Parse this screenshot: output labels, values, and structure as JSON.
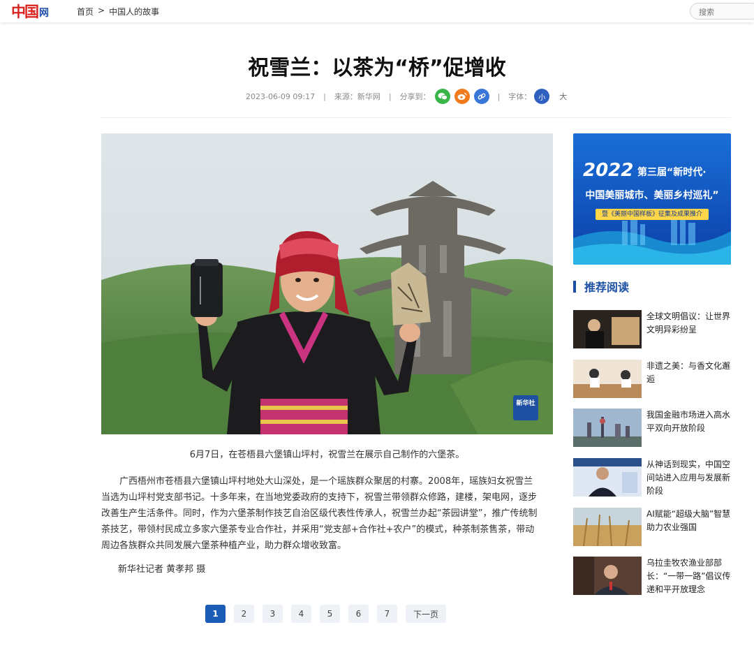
{
  "header": {
    "logo_text": "中国",
    "logo_suffix": "网",
    "breadcrumb": [
      "首页",
      ">",
      "中国人的故事"
    ],
    "search_placeholder": "搜索"
  },
  "article": {
    "title": "祝雪兰：以茶为“桥”促增收",
    "date": "2023-06-09 09:17",
    "source": "来源：新华网",
    "share_label": "分享到：",
    "font_label": "字体：",
    "font_small": "小",
    "font_big": "大",
    "photo_watermark": "新华社",
    "caption": "6月7日，在苍梧县六堡镇山坪村，祝雪兰在展示自己制作的六堡茶。",
    "body": "广西梧州市苍梧县六堡镇山坪村地处大山深处，是一个瑶族群众聚居的村寨。2008年，瑶族妇女祝雪兰当选为山坪村党支部书记。十多年来，在当地党委政府的支持下，祝雪兰带领群众修路，建楼，架电网，逐步改善生产生活条件。同时，作为六堡茶制作技艺自治区级代表性传承人，祝雪兰办起“茶园讲堂”，推广传统制茶技艺，带领村民成立多家六堡茶专业合作社，并采用“党支部+合作社+农户”的模式，种茶制茶售茶，带动周边各族群众共同发展六堡茶种植产业，助力群众增收致富。",
    "credit": "新华社记者 黄孝邦 摄"
  },
  "pagination": {
    "pages": [
      "1",
      "2",
      "3",
      "4",
      "5",
      "6",
      "7"
    ],
    "current": "1",
    "next_label": "下一页"
  },
  "sidebar": {
    "banner": {
      "year": "2022",
      "line1": "第三届“新时代·",
      "line2": "中国美丽城市、美丽乡村巡礼”",
      "line3": "暨《美丽中国样板》征集及成果推介"
    },
    "recommend_title": "推荐阅读",
    "items": [
      {
        "title": "全球文明倡议：让世界文明异彩纷呈"
      },
      {
        "title": "非遗之美：与香文化邂逅"
      },
      {
        "title": "我国金融市场进入高水平双向开放阶段"
      },
      {
        "title": "从神话到现实，中国空间站进入应用与发展新阶段"
      },
      {
        "title": "AI赋能“超级大脑”智慧助力农业强国"
      },
      {
        "title": "乌拉圭牧农渔业部部长：“一带一路”倡议传递和平开放理念"
      }
    ]
  },
  "colors": {
    "accent": "#1b4fa3",
    "brand_red": "#d8231f",
    "pager_active": "#1b5cb6"
  }
}
